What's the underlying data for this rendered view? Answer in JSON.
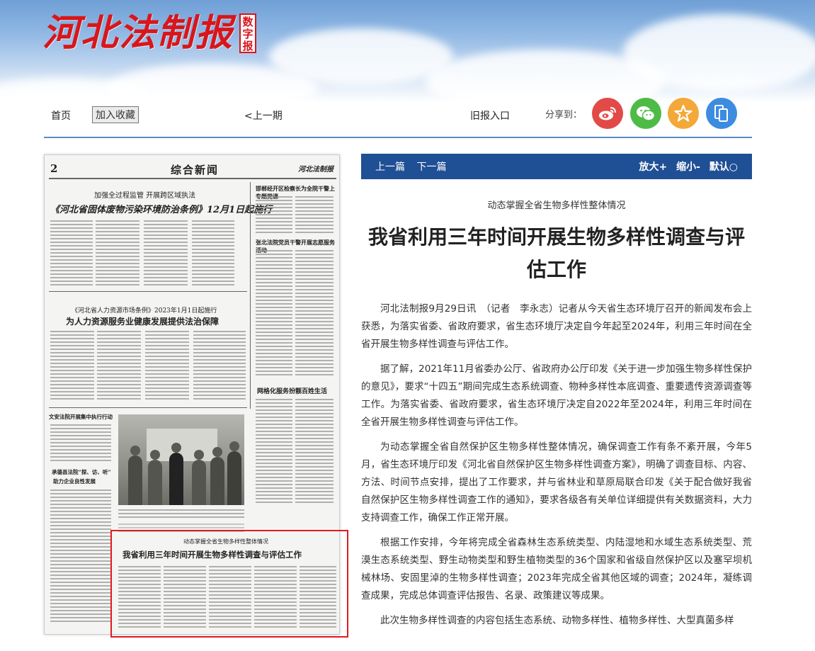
{
  "header": {
    "logo_text": "河北法制报",
    "badge_chars": [
      "数",
      "字",
      "报"
    ]
  },
  "nav": {
    "home": "首页",
    "bookmark": "加入收藏",
    "prev_issue": "<上一期",
    "archive": "旧报入口",
    "share_label": "分享到：",
    "share_icons": [
      "weibo-icon",
      "wechat-icon",
      "qzone-star-icon",
      "mobile-icon"
    ],
    "share_colors": [
      "#e24a48",
      "#4dbb46",
      "#f3a839",
      "#3c8ce0"
    ]
  },
  "newspaper": {
    "page_no": "2",
    "section": "综合新闻",
    "masthead_small": "河北法制报",
    "headlines": [
      "加强全过程监管  开展跨区域执法",
      "《河北省固体废物污染环境防治条例》12月1日起施行",
      "《河北省人力资源市场条例》2023年1月1日起施行",
      "为人力资源服务业健康发展提供法治保障",
      "邯郸经开区检察长为全院干警上专题党课",
      "张北法院党员干警开展志愿服务活动",
      "网格化服务扮靓百姓生活",
      "文安法院开展集中执行行动",
      "承德县法院“探、访、听”",
      "助力企业良性发展",
      "动态掌握全省生物多样性整体情况",
      "我省利用三年时间开展生物多样性调查与评估工作"
    ]
  },
  "article_bar": {
    "prev": "上一篇",
    "next": "下一篇",
    "zoom_in": "放大+",
    "zoom_out": "缩小-",
    "default": "默认○"
  },
  "article": {
    "subtitle": "动态掌握全省生物多样性整体情况",
    "title": "我省利用三年时间开展生物多样性调查与评估工作",
    "paragraphs": [
      "河北法制报9月29日讯　（记者　李永志）记者从今天省生态环境厅召开的新闻发布会上获悉，为落实省委、省政府要求，省生态环境厅决定自今年起至2024年，利用三年时间在全省开展生物多样性调查与评估工作。",
      "据了解，2021年11月省委办公厅、省政府办公厅印发《关于进一步加强生物多样性保护的意见》，要求“十四五”期间完成生态系统调查、物种多样性本底调查、重要遗传资源调查等工作。为落实省委、省政府要求，省生态环境厅决定自2022年至2024年，利用三年时间在全省开展生物多样性调查与评估工作。",
      "为动态掌握全省自然保护区生物多样性整体情况，确保调查工作有条不紊开展，今年5月，省生态环境厅印发《河北省自然保护区生物多样性调查方案》，明确了调查目标、内容、方法、时间节点安排，提出了工作要求，并与省林业和草原局联合印发《关于配合做好我省自然保护区生物多样性调查工作的通知》，要求各级各有关单位详细提供有关数据资料，大力支持调查工作，确保工作正常开展。",
      "根据工作安排，今年将完成全省森林生态系统类型、内陆湿地和水域生态系统类型、荒漠生态系统类型、野生动物类型和野生植物类型的36个国家和省级自然保护区以及塞罕坝机械林场、安固里淖的生物多样性调查；2023年完成全省其他区域的调查；2024年，凝练调查成果，完成总体调查评估报告、名录、政策建议等成果。",
      "此次生物多样性调查的内容包括生态系统、动物多样性、植物多样性、大型真菌多样"
    ]
  },
  "colors": {
    "brand_red": "#d8161b",
    "nav_blue": "#1f4f95",
    "highlight_red": "#e3191f"
  }
}
